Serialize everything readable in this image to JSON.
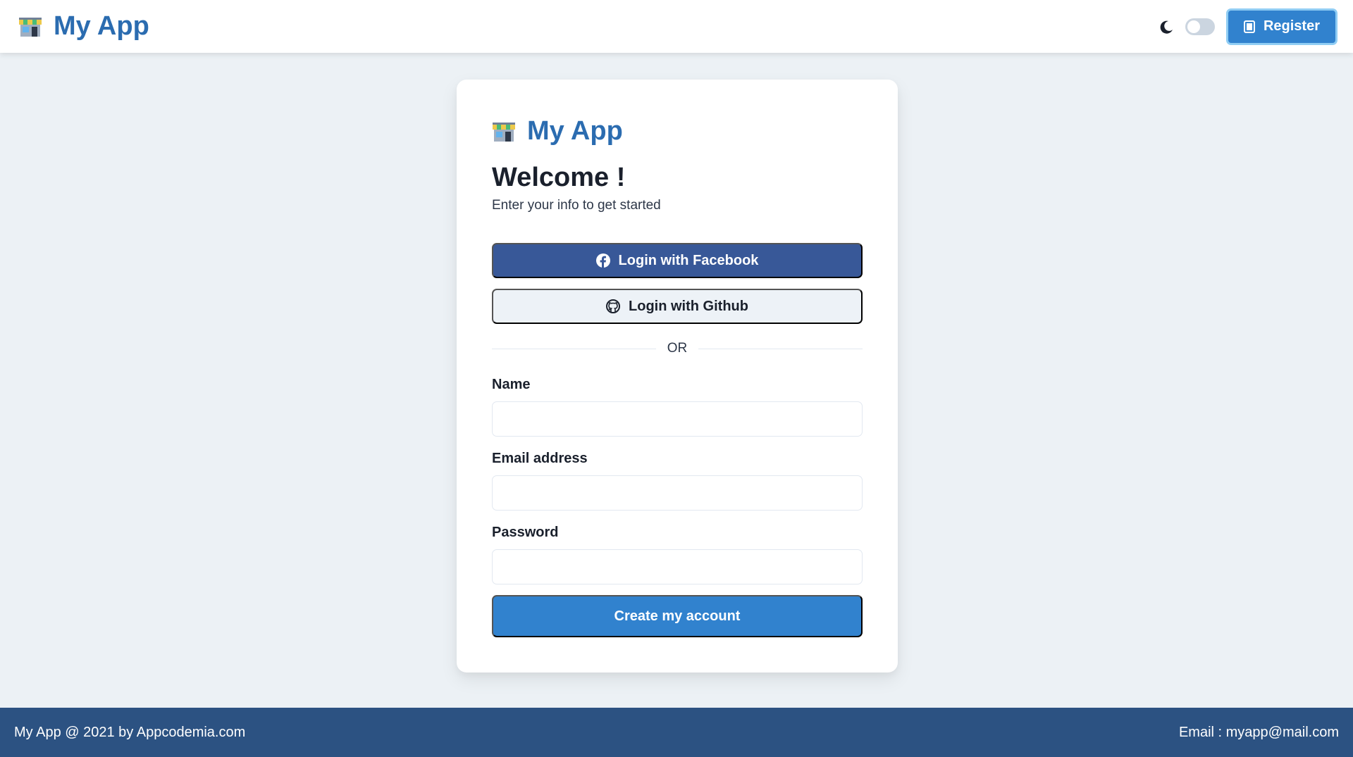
{
  "header": {
    "app_name": "My App",
    "logo_icon": "store-icon",
    "theme_icon": "moon-icon",
    "theme_toggle_state": "off",
    "register_label": "Register"
  },
  "card": {
    "app_name": "My App",
    "title": "Welcome !",
    "subtitle": "Enter your info to get started",
    "facebook_label": "Login with Facebook",
    "github_label": "Login with Github",
    "divider_text": "OR",
    "name_label": "Name",
    "name_value": "",
    "email_label": "Email address",
    "email_value": "",
    "password_label": "Password",
    "password_value": "",
    "submit_label": "Create my account"
  },
  "footer": {
    "left_text": "My App @ 2021 by Appcodemia.com",
    "right_text": "Email : myapp@mail.com"
  },
  "colors": {
    "brand": "#2b6cb0",
    "primary": "#3182ce",
    "facebook": "#385898",
    "footer_bg": "#2c5282",
    "page_bg": "#ecf1f5"
  }
}
